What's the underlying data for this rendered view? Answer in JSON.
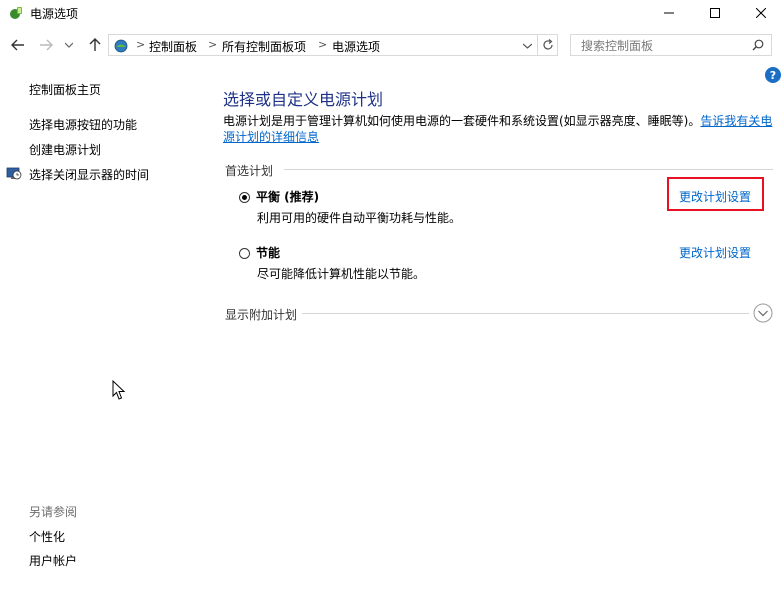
{
  "window": {
    "title": "电源选项",
    "controls": {
      "minimize": "—",
      "maximize": "☐",
      "close": "✕"
    }
  },
  "nav": {
    "back_icon": "arrow-left-icon",
    "forward_icon": "arrow-right-icon",
    "recent_icon": "chevron-down-icon",
    "up_icon": "arrow-up-icon"
  },
  "address": {
    "crumbs": [
      "控制面板",
      "所有控制面板项",
      "电源选项"
    ],
    "separator": ">"
  },
  "search": {
    "placeholder": "搜索控制面板"
  },
  "sidebar": {
    "home": "控制面板主页",
    "links": [
      "选择电源按钮的功能",
      "创建电源计划",
      "选择关闭显示器的时间"
    ],
    "see_also_heading": "另请参阅",
    "see_also": [
      "个性化",
      "用户帐户"
    ]
  },
  "main": {
    "title": "选择或自定义电源计划",
    "description": "电源计划是用于管理计算机如何使用电源的一套硬件和系统设置(如显示器亮度、睡眠等)。",
    "description_link": "告诉我有关电源计划的详细信息",
    "preferred_heading": "首选计划",
    "plans": [
      {
        "name": "平衡 (推荐)",
        "desc": "利用可用的硬件自动平衡功耗与性能。",
        "link": "更改计划设置",
        "selected": true
      },
      {
        "name": "节能",
        "desc": "尽可能降低计算机性能以节能。",
        "link": "更改计划设置",
        "selected": false
      }
    ],
    "additional_heading": "显示附加计划"
  },
  "colors": {
    "title_blue": "#1e3287",
    "link_blue": "#0066cc",
    "highlight_red": "#e81123"
  }
}
